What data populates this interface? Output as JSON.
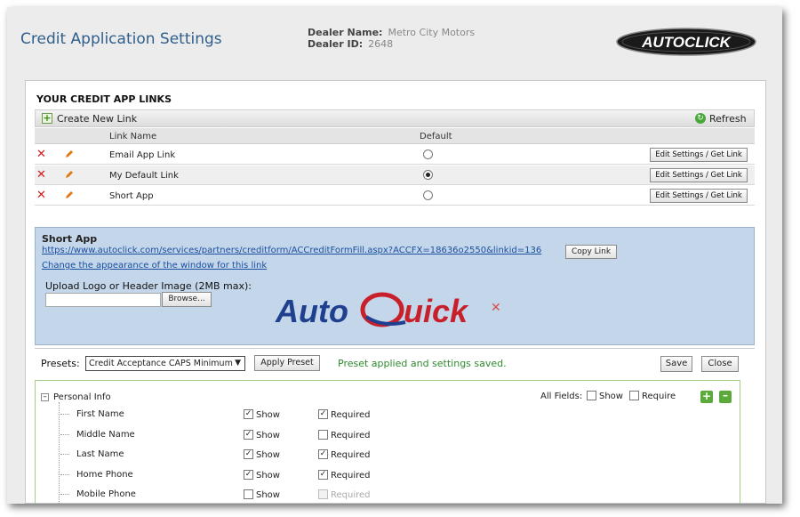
{
  "header": {
    "title": "Credit Application Settings",
    "dealer_name_label": "Dealer Name:",
    "dealer_name": "Metro City Motors",
    "dealer_id_label": "Dealer ID:",
    "dealer_id": "2648",
    "logo_text": "AUTOCLICK"
  },
  "links_section": {
    "title": "YOUR CREDIT APP LINKS",
    "create_label": "Create New Link",
    "refresh_label": "Refresh",
    "col_name": "Link Name",
    "col_default": "Default",
    "action_label": "Edit Settings / Get Link",
    "rows": [
      {
        "name": "Email App Link",
        "default": false
      },
      {
        "name": "My Default Link",
        "default": true
      },
      {
        "name": "Short App",
        "default": false
      }
    ]
  },
  "short_app": {
    "title": "Short App",
    "url": "https://www.autoclick.com/services/partners/creditform/ACCreditFormFill.aspx?ACCFX=18636o2550&linkid=136",
    "copy_label": "Copy Link",
    "change_link": "Change the appearance of the window for this link",
    "upload_label": "Upload Logo or Header Image (2MB max):",
    "browse_label": "Browse...",
    "logo_text_1": "Auto",
    "logo_text_2": "uick"
  },
  "presets": {
    "label": "Presets:",
    "selected": "Credit Acceptance CAPS Minimum",
    "apply_label": "Apply Preset",
    "status": "Preset applied and settings saved.",
    "save_label": "Save",
    "close_label": "Close"
  },
  "fields": {
    "group_name": "Personal Info",
    "all_fields_label": "All Fields:",
    "all_show_label": "Show",
    "all_require_label": "Require",
    "show_label": "Show",
    "required_label": "Required",
    "rows": [
      {
        "name": "First Name",
        "show": true,
        "required": true,
        "required_enabled": true
      },
      {
        "name": "Middle Name",
        "show": true,
        "required": false,
        "required_enabled": true
      },
      {
        "name": "Last Name",
        "show": true,
        "required": true,
        "required_enabled": true
      },
      {
        "name": "Home Phone",
        "show": true,
        "required": true,
        "required_enabled": true
      },
      {
        "name": "Mobile Phone",
        "show": false,
        "required": false,
        "required_enabled": false
      }
    ]
  },
  "colors": {
    "title_blue": "#2f5e8c",
    "status_green": "#2e8b2e",
    "delete_red": "#d41a1a",
    "short_app_bg": "#c4d6ea"
  }
}
